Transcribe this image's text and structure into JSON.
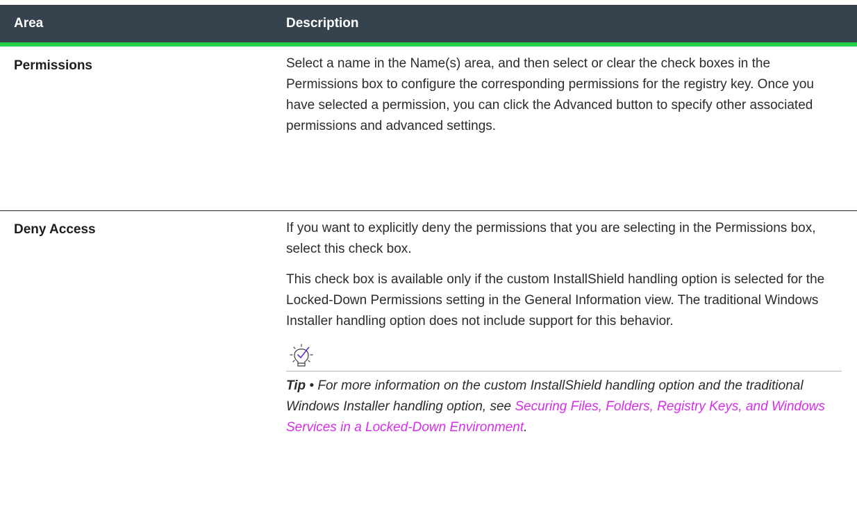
{
  "table": {
    "headers": {
      "area": "Area",
      "description": "Description"
    },
    "rows": [
      {
        "area": "Permissions",
        "paragraphs": [
          "Select a name in the Name(s) area, and then select or clear the check boxes in the Permissions box to configure the corresponding permissions for the registry key. Once you have selected a permission, you can click the Advanced button to specify other associated permissions and advanced settings."
        ]
      },
      {
        "area": "Deny Access",
        "paragraphs": [
          "If you want to explicitly deny the permissions that you are selecting in the Permissions box, select this check box.",
          "This check box is available only if the custom InstallShield handling option is selected for the Locked-Down Permissions setting in the General Information view. The traditional Windows Installer handling option does not include support for this behavior."
        ],
        "tip": {
          "icon": "lightbulb-check-icon",
          "label": "Tip",
          "separator": " • ",
          "text": "For more information on the custom InstallShield handling option and the traditional Windows Installer handling option, see ",
          "link_text": "Securing Files, Folders, Registry Keys, and Windows Services in a Locked-Down Environment",
          "after_link": "."
        }
      }
    ]
  },
  "colors": {
    "header_bg": "#36434e",
    "header_accent": "#24d04a",
    "link": "#d62ee8",
    "text": "#2b2b2b"
  }
}
